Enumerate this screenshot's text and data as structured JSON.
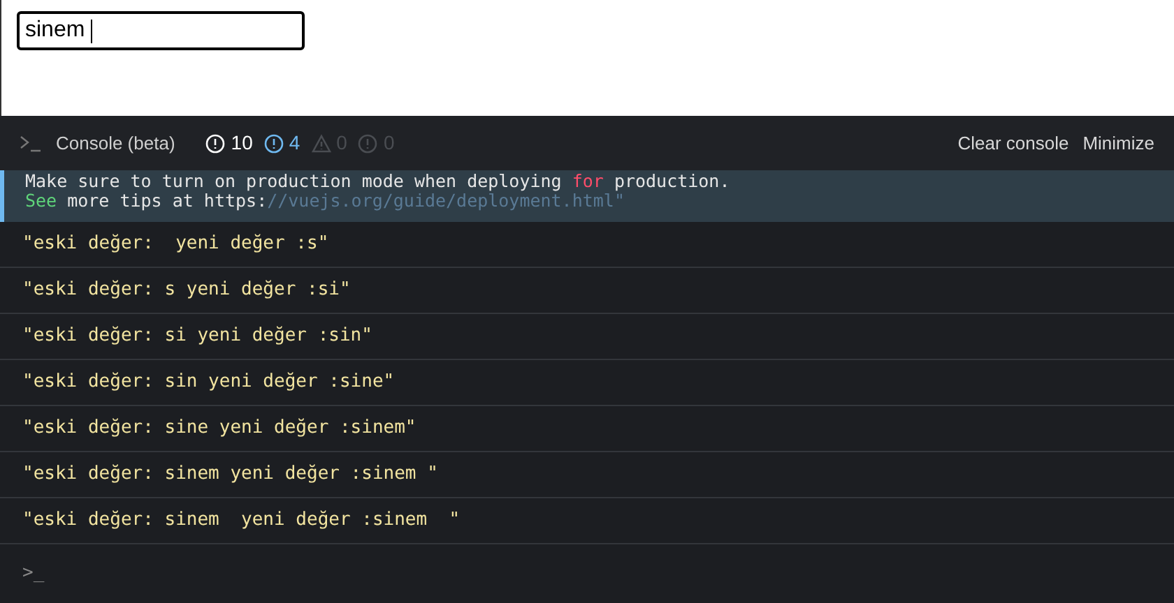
{
  "input": {
    "value": "sinem "
  },
  "console": {
    "title": "Console (beta)",
    "counters": [
      {
        "kind": "info",
        "count": "10",
        "color": "#ffffff"
      },
      {
        "kind": "info",
        "count": "4",
        "color": "#6fb9f0"
      },
      {
        "kind": "warning",
        "count": "0",
        "color": "#4a4d52"
      },
      {
        "kind": "error",
        "count": "0",
        "color": "#4a4d52"
      }
    ],
    "actions": [
      "Clear console",
      "Minimize"
    ],
    "notice": {
      "lines": [
        [
          {
            "kind": "plain",
            "text": "Make sure to turn on production mode when deploying "
          },
          {
            "kind": "keyword",
            "text": "for"
          },
          {
            "kind": "plain",
            "text": " production."
          }
        ],
        [
          {
            "kind": "keyword-green",
            "text": "See"
          },
          {
            "kind": "plain",
            "text": " more tips at https:"
          },
          {
            "kind": "comment",
            "text": "//vuejs.org/guide/deployment.html\""
          }
        ]
      ]
    },
    "logs": [
      "\"eski değer:  yeni değer :s\"",
      "\"eski değer: s yeni değer :si\"",
      "\"eski değer: si yeni değer :sin\"",
      "\"eski değer: sin yeni değer :sine\"",
      "\"eski değer: sine yeni değer :sinem\"",
      "\"eski değer: sinem yeni değer :sinem \"",
      "\"eski değer: sinem  yeni değer :sinem  \""
    ],
    "prompt": ">_"
  }
}
